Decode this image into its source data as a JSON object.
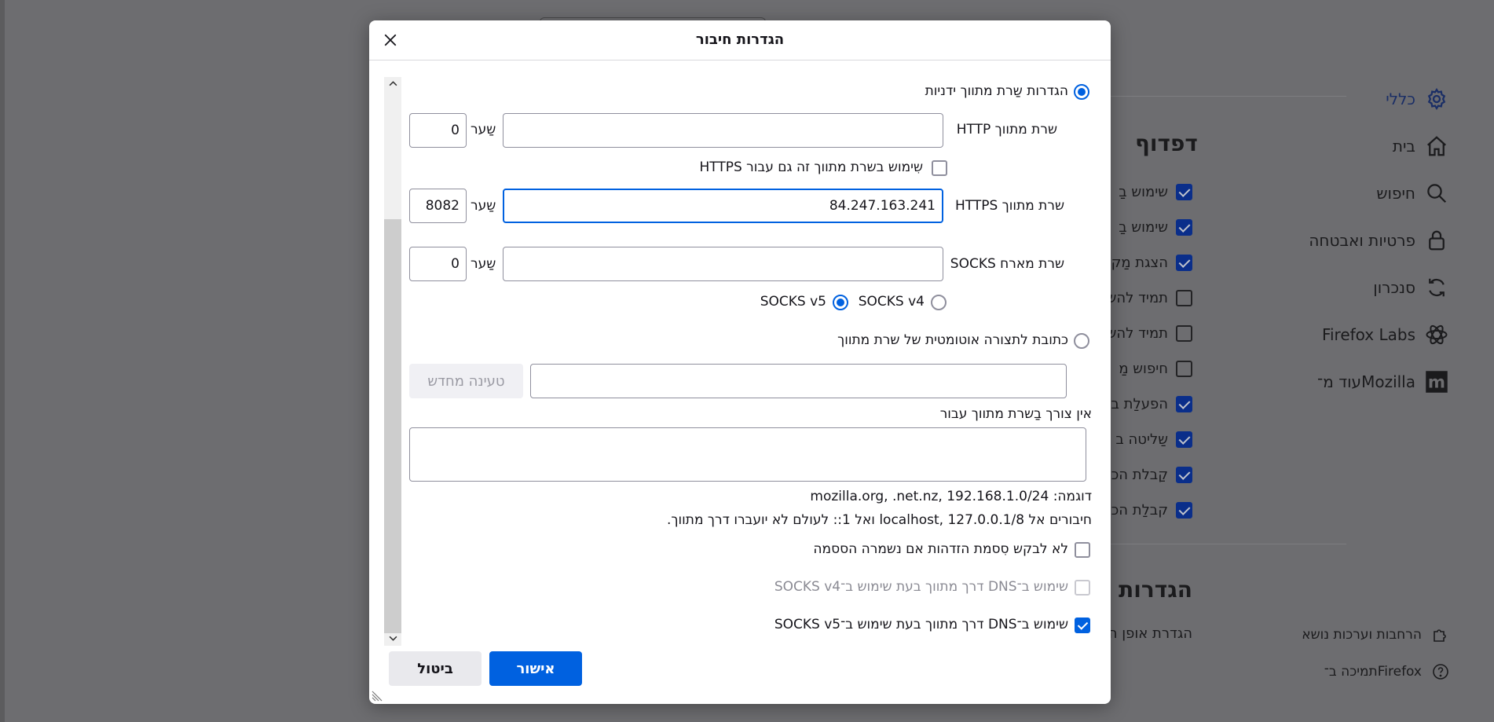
{
  "background": {
    "nav": [
      {
        "label": "כללי",
        "icon": "gear-icon",
        "active": true
      },
      {
        "label": "בית",
        "icon": "home-icon"
      },
      {
        "label": "חיפוש",
        "icon": "search-icon"
      },
      {
        "label": "פרטיות ואבטחה",
        "icon": "lock-icon"
      },
      {
        "label": "סנכרון",
        "icon": "sync-icon"
      },
      {
        "label": "Firefox Labs",
        "icon": "labs-icon"
      },
      {
        "label": "עוד מ־Mozilla",
        "icon": "mozilla-icon"
      }
    ],
    "section_browsing": "דפדוף",
    "section_network": "הגדרות ר",
    "network_sub": "הגדרת אופן ה",
    "checkbox_items": [
      {
        "label": "שימוש בַ",
        "checked": true
      },
      {
        "label": "שימוש בַ",
        "checked": true
      },
      {
        "label": "הצגת מַק",
        "checked": true
      },
      {
        "label": "תמיד להש",
        "checked": false
      },
      {
        "label": "תמיד להש",
        "checked": false
      },
      {
        "label": "חיפוש מַ",
        "checked": false
      },
      {
        "label": "הפעלַת ב",
        "checked": true
      },
      {
        "label": "שַליטה ב",
        "checked": true
      },
      {
        "label": "קַבלת הכ",
        "checked": true
      },
      {
        "label": "קבלַת הכ",
        "checked": true
      }
    ],
    "footer": {
      "extensions": "הרחבות וערכות נושא",
      "support": "תמיכה ב־Firefox"
    }
  },
  "dialog": {
    "title": "הגדרות חיבור",
    "manual_proxy_label": "הגדרות שַרת מתווך ידניות",
    "http_proxy_label": "שרת מתווך HTTP",
    "http_proxy_value": "",
    "port_label": "שַער",
    "http_port_value": "0",
    "also_https_label": "שִימוש בשרת מתווך זה גם עבור HTTPS",
    "https_proxy_label": "שרת מתווך HTTPS",
    "https_proxy_value": "84.247.163.241",
    "https_port_value": "8082",
    "socks_label": "שרת מארח SOCKS",
    "socks_value": "",
    "socks_port_value": "0",
    "socks_v4": "SOCKS v4",
    "socks_v5": "SOCKS v5",
    "auto_config_label": "כתובת לתצורה אוטומטית של שרת מתווך",
    "auto_config_value": "",
    "reload_button": "טעינה מחדש",
    "no_proxy_label": "אין צורך בַשרת מתווך עבור",
    "no_proxy_value": "",
    "example": "דוגמה: mozilla.org, .net.nz, 192.168.1.0/24",
    "localhost_note": "חיבורים אל localhost, 127.0.0.1/8 ואל 1:: לעולם לא יועברו דרך מתווך.",
    "no_auth_prompt": "לא לבקש סִסמת הזדהות אם נשמרה הססמה",
    "dns_socks4": "שימוש ב־DNS דרך מתווך בעת שימוש ב־SOCKS v4",
    "dns_socks5": "שימוש ב־DNS דרך מתווך בעת שימוש ב־SOCKS v5",
    "ok_button": "אישור",
    "cancel_button": "ביטול"
  },
  "colors": {
    "accent": "#0061e0",
    "overlay": "#6d6d70"
  }
}
